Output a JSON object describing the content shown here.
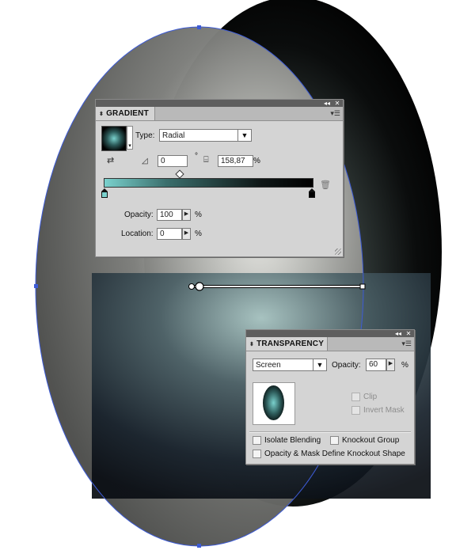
{
  "colors": {
    "panel_bg": "#d4d4d4",
    "panel_titlebar": "#5e5e5e",
    "selection_path": "#3d5bd6",
    "gradient_start": "#7ad1cd",
    "gradient_end": "#000000"
  },
  "gradient_panel": {
    "tab_label": "GRADIENT",
    "type_label": "Type:",
    "type_value": "Radial",
    "angle_value": "0",
    "angle_unit": "°",
    "aspect_value": "158,87",
    "aspect_unit": "%",
    "opacity_label": "Opacity:",
    "opacity_value": "100",
    "opacity_unit": "%",
    "location_label": "Location:",
    "location_value": "0",
    "location_unit": "%",
    "icons": [
      "swatch-preview-icon",
      "reverse-gradient-icon",
      "angle-icon",
      "aspect-ratio-icon",
      "trash-icon",
      "panel-menu-icon"
    ]
  },
  "transparency_panel": {
    "tab_label": "TRANSPARENCY",
    "blend_mode": "Screen",
    "opacity_label": "Opacity:",
    "opacity_value": "60",
    "opacity_unit": "%",
    "clip_label": "Clip",
    "invert_mask_label": "Invert Mask",
    "isolate_blending_label": "Isolate Blending",
    "knockout_group_label": "Knockout Group",
    "opacity_mask_label": "Opacity & Mask Define Knockout Shape"
  }
}
